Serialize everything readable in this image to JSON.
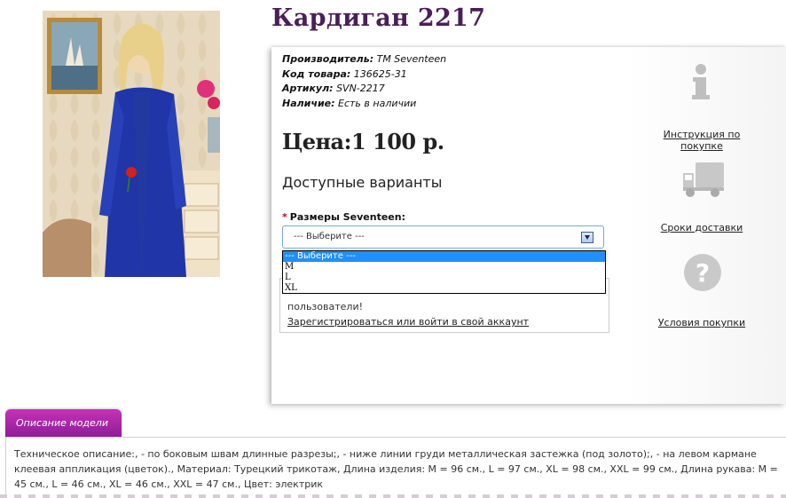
{
  "product": {
    "title": "Кардиган 2217",
    "photo_alt": "Кардиган 2217"
  },
  "info": {
    "manufacturer_label": "Производитель:",
    "manufacturer_value": "TM Seventeen",
    "code_label": "Код товара:",
    "code_value": "136625-31",
    "article_label": "Артикул:",
    "article_value": "SVN-2217",
    "availability_label": "Наличие:",
    "availability_value": "Есть в наличии"
  },
  "price": "Цена:1 100 р.",
  "variants": {
    "heading": "Доступные варианты",
    "size_required_mark": "*",
    "size_label": "Размеры Seventeen:",
    "selected": "--- Выберите ---",
    "options": [
      "--- Выберите ---",
      "M",
      "L",
      "XL"
    ]
  },
  "notice": {
    "text": "пользователи!",
    "link": "Зарегистрироваться или войти в свой аккаунт"
  },
  "sidebar": {
    "instruction_icon": "info-icon",
    "instruction_link": "Инструкция по покупке",
    "delivery_icon": "truck-icon",
    "delivery_link": "Сроки доставки",
    "terms_icon": "question-icon",
    "terms_link": "Условия покупки"
  },
  "tabs": {
    "description_label": "Описание модели"
  },
  "description": "Техническое описание:, - по боковым швам длинные разрезы;, - ниже линии груди металлическая застежка (под золото);, - на левом кармане клеевая аппликация (цветок)., Материал: Турецкий трикотаж, Длина изделия: M = 96 см., L = 97 см., XL = 98 см., XXL = 99 см., Длина рукава: M = 45 см., L = 46 см., XL = 46 см., XXL = 47 см., Цвет: электрик",
  "colors": {
    "title": "#4a1f57",
    "tab_top": "#c532b5",
    "tab_bottom": "#8d1c9b",
    "dropdown_highlight": "#1e90ff",
    "required": "#d0021b"
  }
}
